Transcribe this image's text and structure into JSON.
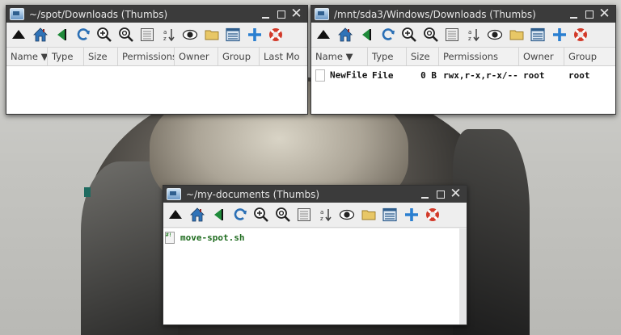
{
  "windows": {
    "w1": {
      "title": "~/spot/Downloads (Thumbs)",
      "columns": [
        "Name ▼",
        "Type",
        "Size",
        "Permissions",
        "Owner",
        "Group",
        "Last Mo"
      ],
      "rows": []
    },
    "w2": {
      "title": "/mnt/sda3/Windows/Downloads (Thumbs)",
      "columns": [
        "Name ▼",
        "Type",
        "Size",
        "Permissions",
        "Owner",
        "Group"
      ],
      "rows": [
        {
          "name": "NewFile",
          "type": "File",
          "size": "0 B",
          "permissions": "rwx,r-x,r-x/---",
          "owner": "root",
          "group": "root"
        }
      ]
    },
    "w3": {
      "title": "~/my-documents (Thumbs)",
      "items": [
        {
          "name": "move-spot.sh"
        }
      ]
    }
  },
  "window_controls": {
    "minimize_glyph": "—",
    "maximize_glyph": "□",
    "close_glyph": "✕"
  },
  "toolbar_icons": [
    "up-icon",
    "home-icon",
    "back-icon",
    "refresh-icon",
    "zoom-in-icon",
    "zoom-out-icon",
    "thumbs-view-icon",
    "sort-icon",
    "hidden-files-eye-icon",
    "folder-icon",
    "detail-view-icon",
    "new-icon",
    "help-lifebuoy-icon"
  ],
  "colors": {
    "titlebar": "#3b3b3b",
    "toolbar": "#eeeeee",
    "list_bg": "#ffffff",
    "script_name": "#1e6b1e"
  }
}
